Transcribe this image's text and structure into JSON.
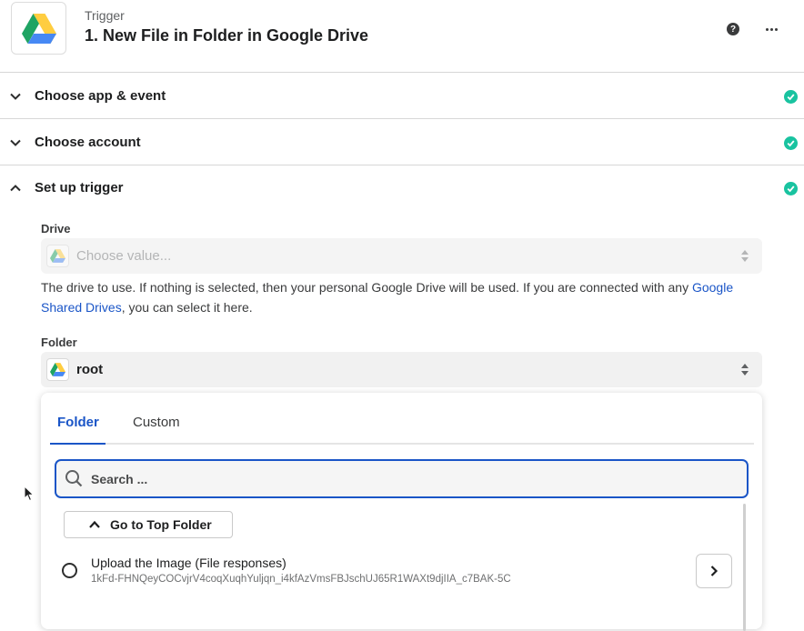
{
  "header": {
    "kind": "Trigger",
    "title": "1. New File in Folder in Google Drive",
    "help_icon": "question-circle-icon",
    "more_icon": "ellipsis-icon",
    "logo_icon": "google-drive-icon"
  },
  "sections": [
    {
      "label": "Choose app & event",
      "status": "complete",
      "expanded": false
    },
    {
      "label": "Choose account",
      "status": "complete",
      "expanded": false
    },
    {
      "label": "Set up trigger",
      "status": "complete",
      "expanded": true
    }
  ],
  "drive_field": {
    "label": "Drive",
    "placeholder": "Choose value...",
    "help_before": "The drive to use. If nothing is selected, then your personal Google Drive will be used. If you are connected with any ",
    "help_link": "Google Shared Drives",
    "help_after": ", you can select it here."
  },
  "folder_field": {
    "label": "Folder",
    "value": "root"
  },
  "dropdown": {
    "tabs": [
      {
        "label": "Folder",
        "active": true
      },
      {
        "label": "Custom",
        "active": false
      }
    ],
    "search_placeholder": "Search ...",
    "top_folder_label": "Go to Top Folder",
    "items": [
      {
        "title": "Upload the Image (File responses)",
        "id": "1kFd-FHNQeyCOCvjrV4coqXuqhYuljqn_i4kfAzVmsFBJschUJ65R1WAXt9djIIA_c7BAK-5C"
      }
    ]
  },
  "colors": {
    "accent": "#1a55c7",
    "success": "#19c3a0",
    "divider": "#d7d7d7"
  }
}
